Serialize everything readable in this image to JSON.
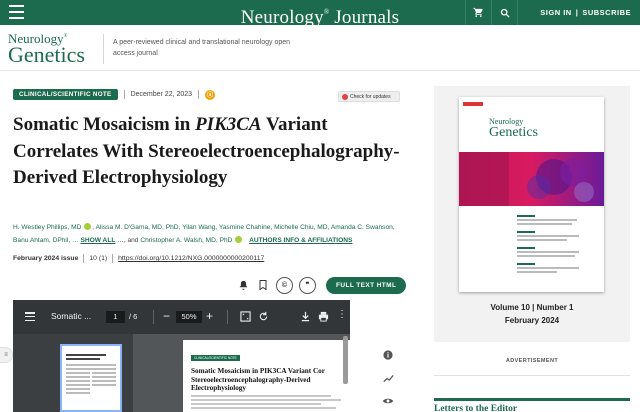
{
  "topbar": {
    "brand": "Neurology",
    "brand_mark": "®",
    "brand_suffix": "Journals",
    "sign_in": "SIGN IN",
    "divider": "|",
    "subscribe": "SUBSCRIBE",
    "icons": [
      "menu-icon",
      "cart-icon",
      "search-icon"
    ],
    "color": "#1c6b4e"
  },
  "journal": {
    "logo_top": "Neurology",
    "logo_mark": "®",
    "logo_bottom": "Genetics",
    "tagline": "A peer-reviewed clinical and translational neurology open access journal"
  },
  "article": {
    "badge": "CLINICAL/SCIENTIFIC NOTE",
    "date": "December 22, 2023",
    "open_access_icon": "open-access-icon",
    "check_updates": "Check for updates",
    "title_part1": "Somatic Mosaicism in ",
    "title_gene": "PIK3CA",
    "title_part2": " Variant Correlates With Stereoelectroencephalography-Derived Electrophysiology",
    "authors": {
      "a1": "H. Westley Phillips, MD",
      "a2": "Alissa M. D'Gama, MD, PhD, Yilan Wang, Yasmine Chahine, Michelle Chiu, MD, Amanda C. Swanson, Banu Ahtam, DPhil, …",
      "show_all": "SHOW ALL",
      "a3_prefix": "…, and ",
      "a3": "Christopher A. Walsh, MD, PhD",
      "info": "AUTHORS INFO & AFFILIATIONS"
    },
    "issue": "February 2024 issue",
    "volume_issue": "10 (1)",
    "doi": "https://doi.org/10.1212/NXG.0000000000200117",
    "full_text": "FULL TEXT HTML"
  },
  "pdf_viewer": {
    "title": "Somatic ...",
    "page": "1",
    "page_total": "/ 6",
    "zoom": "50%",
    "zoom_minus": "−",
    "zoom_plus": "+",
    "page_badge": "CLINICAL/SCIENTIFIC NOTE",
    "page_title_1": "Somatic Mosaicism in PIK3CA Variant Cor",
    "page_title_2": "Stereoelectroencephalography-Derived",
    "page_title_3": "Electrophysiology"
  },
  "sidebar": {
    "cover_top": "Neurology",
    "cover_bottom": "Genetics",
    "volume": "Volume 10 | Number 1",
    "issue_date": "February 2024",
    "advertisement": "ADVERTISEMENT",
    "letters_heading": "Letters to the Editor"
  }
}
